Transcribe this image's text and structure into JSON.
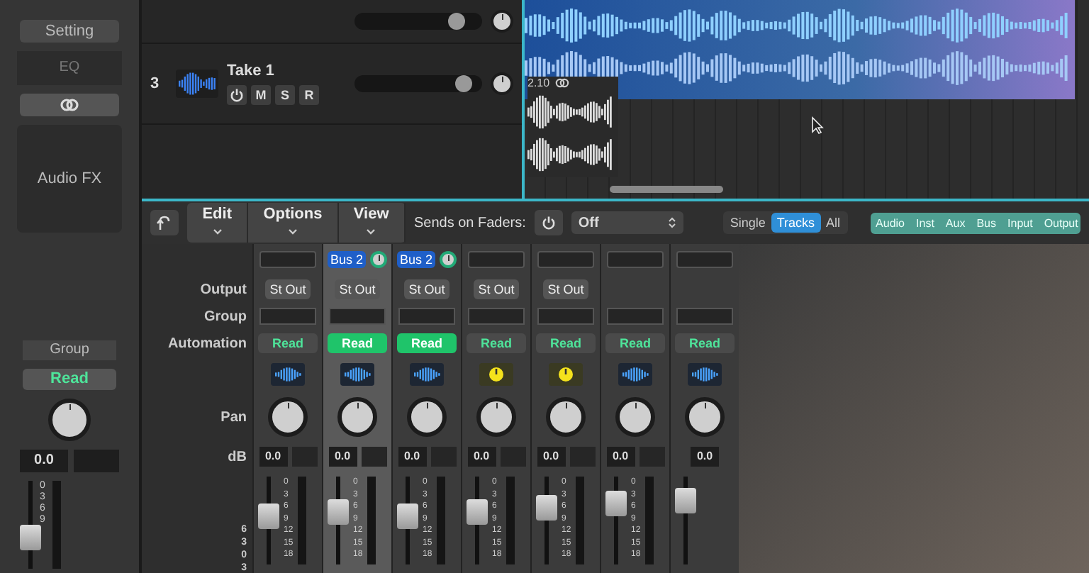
{
  "inspector": {
    "setting": "Setting",
    "eq": "EQ",
    "audio_fx": "Audio FX",
    "group": "Group",
    "automation": "Read",
    "volume": "0.0",
    "meter_ticks": [
      "0",
      "3",
      "6",
      "9"
    ],
    "fader": {
      "level": 0.35
    }
  },
  "upper_track": {
    "level": 0.8
  },
  "tracks": [
    {
      "number": "3",
      "name": "Take 1",
      "buttons": [
        "M",
        "S",
        "R"
      ],
      "level": 0.86
    }
  ],
  "region": {
    "label": "2.10"
  },
  "toolbar": {
    "menus": [
      "Edit",
      "Options",
      "View"
    ],
    "sends_label": "Sends on Faders:",
    "sends_value": "Off",
    "view_modes": [
      {
        "label": "Single",
        "selected": false
      },
      {
        "label": "Tracks",
        "selected": true
      },
      {
        "label": "All",
        "selected": false
      }
    ],
    "filters": [
      {
        "label": "Audio",
        "on": true
      },
      {
        "label": "Inst",
        "on": true
      },
      {
        "label": "Aux",
        "on": true
      },
      {
        "label": "Bus",
        "on": true
      },
      {
        "label": "Input",
        "on": true
      },
      {
        "label": "Output",
        "on": true
      }
    ]
  },
  "mixer": {
    "row_labels": [
      "Output",
      "Group",
      "Automation",
      "Pan",
      "dB"
    ],
    "fader_scale": [
      "6",
      "3",
      "0",
      "3"
    ],
    "strips": [
      {
        "selected": false,
        "output": "St Out",
        "automation": "Read",
        "automation_on": false,
        "kind": "audio",
        "db": "0.0",
        "meter_ticks": [
          "0",
          "3",
          "6",
          "9",
          "12",
          "15",
          "18"
        ],
        "fader": {
          "level": 0.55
        }
      },
      {
        "selected": true,
        "send": "Bus 2",
        "output": "St Out",
        "automation": "Read",
        "automation_on": true,
        "kind": "audio",
        "db": "0.0",
        "meter_ticks": [
          "0",
          "3",
          "6",
          "9",
          "12",
          "15",
          "18"
        ],
        "fader": {
          "level": 0.6
        }
      },
      {
        "selected": false,
        "send": "Bus 2",
        "output": "St Out",
        "automation": "Read",
        "automation_on": true,
        "kind": "audio",
        "db": "0.0",
        "meter_ticks": [
          "0",
          "3",
          "6",
          "9",
          "12",
          "15",
          "18"
        ],
        "fader": {
          "level": 0.55
        }
      },
      {
        "selected": false,
        "output": "St Out",
        "automation": "Read",
        "automation_on": false,
        "kind": "aux",
        "db": "0.0",
        "meter_ticks": [
          "0",
          "3",
          "6",
          "9",
          "12",
          "15",
          "18"
        ],
        "fader": {
          "level": 0.6
        }
      },
      {
        "selected": false,
        "output": "St Out",
        "automation": "Read",
        "automation_on": false,
        "kind": "aux",
        "db": "0.0",
        "meter_ticks": [
          "0",
          "3",
          "6",
          "9",
          "12",
          "15",
          "18"
        ],
        "fader": {
          "level": 0.65
        }
      },
      {
        "selected": false,
        "automation": "Read",
        "automation_on": false,
        "kind": "audio",
        "db": "0.0",
        "meter_ticks": [
          "0",
          "3",
          "6",
          "9",
          "12",
          "15",
          "18"
        ],
        "fader": {
          "level": 0.7
        }
      },
      {
        "selected": false,
        "automation": "Read",
        "automation_on": false,
        "kind": "audio",
        "db": "0.0",
        "fader": {
          "level": 0.72
        }
      }
    ]
  }
}
